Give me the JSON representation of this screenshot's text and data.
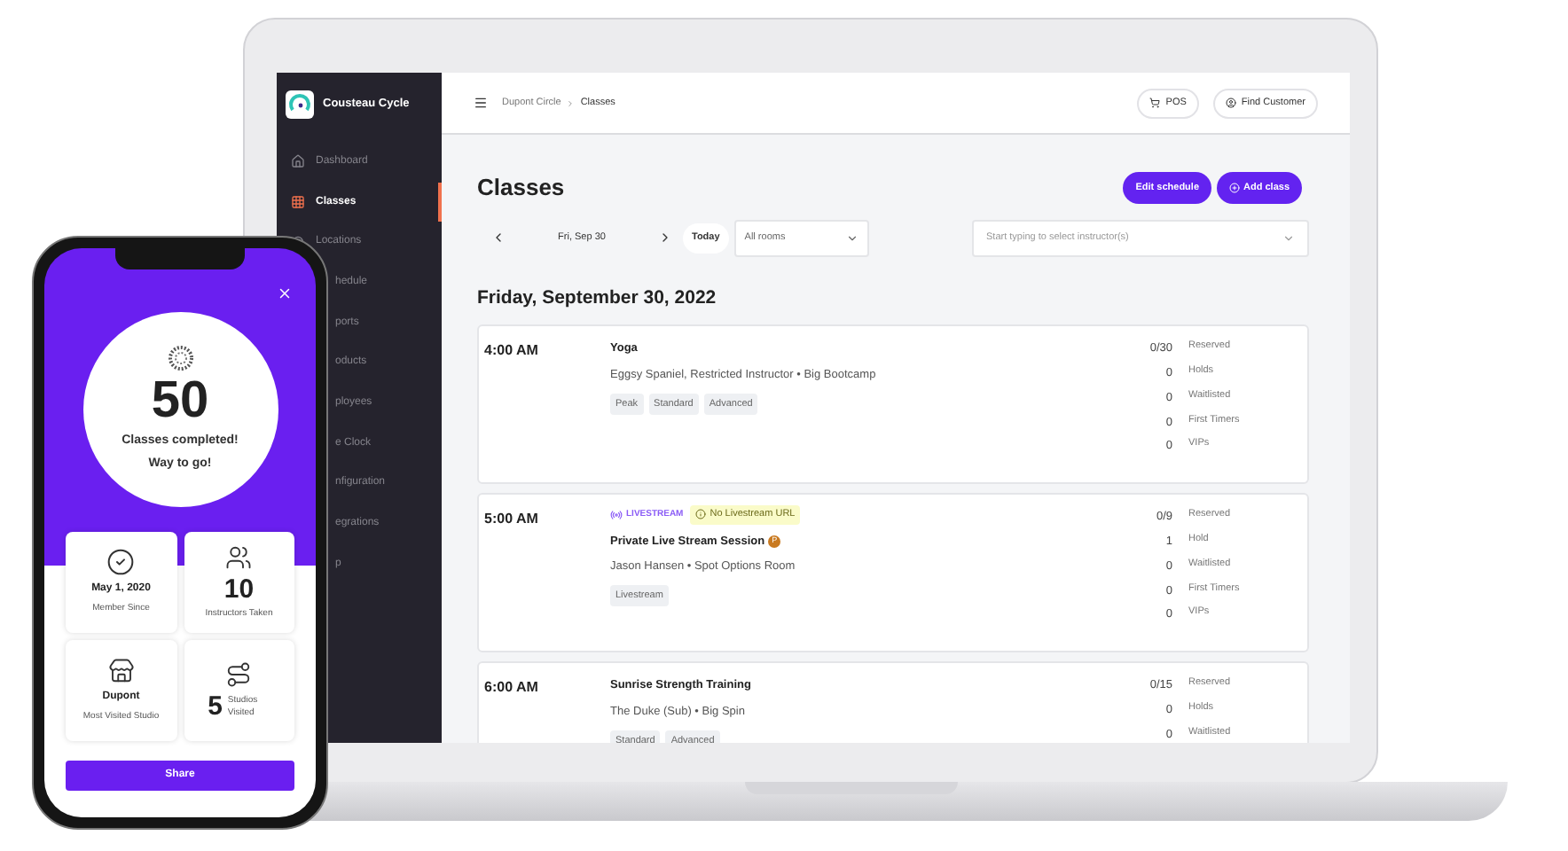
{
  "laptop": {
    "sidebar": {
      "brand": "Cousteau Cycle",
      "items": [
        {
          "label": "Dashboard",
          "selected": false
        },
        {
          "label": "Classes",
          "selected": true
        },
        {
          "label": "Locations",
          "selected": false
        },
        {
          "label": "hedule",
          "selected": false
        },
        {
          "label": "ports",
          "selected": false
        },
        {
          "label": "oducts",
          "selected": false
        },
        {
          "label": "ployees",
          "selected": false
        },
        {
          "label": "e Clock",
          "selected": false
        },
        {
          "label": "nfiguration",
          "selected": false
        },
        {
          "label": "egrations",
          "selected": false
        },
        {
          "label": "p",
          "selected": false
        }
      ]
    },
    "header": {
      "breadcrumb": [
        "Dupont Circle",
        "Classes"
      ],
      "buttons": [
        "POS",
        "Find Customer"
      ]
    },
    "page": {
      "title": "Classes",
      "actions": [
        "Edit schedule",
        "Add class"
      ],
      "date": "Fri, Sep 30",
      "today": "Today",
      "rooms_select": {
        "value": "All rooms"
      },
      "instructor_select": {
        "placeholder": "Start typing to select instructor(s)"
      },
      "day_heading": "Friday, September 30, 2022",
      "classes": [
        {
          "time": "4:00 AM",
          "name": "Yoga",
          "details": "Eggsy Spaniel, Restricted Instructor • Big Bootcamp",
          "tags": [
            "Peak",
            "Standard",
            "Advanced"
          ],
          "stats": [
            {
              "value": "0/30",
              "label": "Reserved"
            },
            {
              "value": "0",
              "label": "Holds"
            },
            {
              "value": "0",
              "label": "Waitlisted"
            },
            {
              "value": "0",
              "label": "First Timers"
            },
            {
              "value": "0",
              "label": "VIPs"
            }
          ]
        },
        {
          "time": "5:00 AM",
          "livestream": {
            "label": "LIVESTREAM",
            "warning": "No Livestream URL"
          },
          "name": "Private Live Stream Session",
          "badge": "P",
          "details": "Jason Hansen • Spot Options Room",
          "tags": [
            "Livestream"
          ],
          "stats": [
            {
              "value": "0/9",
              "label": "Reserved"
            },
            {
              "value": "1",
              "label": "Hold"
            },
            {
              "value": "0",
              "label": "Waitlisted"
            },
            {
              "value": "0",
              "label": "First Timers"
            },
            {
              "value": "0",
              "label": "VIPs"
            }
          ]
        },
        {
          "time": "6:00 AM",
          "name": "Sunrise Strength Training",
          "details": "The Duke (Sub) • Big Spin",
          "tags": [
            "Standard",
            "Advanced"
          ],
          "stats": [
            {
              "value": "0/15",
              "label": "Reserved"
            },
            {
              "value": "0",
              "label": "Holds"
            },
            {
              "value": "0",
              "label": "Waitlisted"
            }
          ]
        }
      ]
    }
  },
  "phone": {
    "count": "50",
    "message": "Classes completed!",
    "cheer": "Way to go!",
    "cards": [
      {
        "kind": "date",
        "value": "May 1, 2020",
        "label": "Member Since"
      },
      {
        "kind": "count",
        "value": "10",
        "label": "Instructors Taken"
      },
      {
        "kind": "studio",
        "value": "Dupont",
        "label": "Most Visited Studio"
      },
      {
        "kind": "inline",
        "value": "5",
        "label": "Studios Visited"
      }
    ],
    "share": "Share"
  }
}
